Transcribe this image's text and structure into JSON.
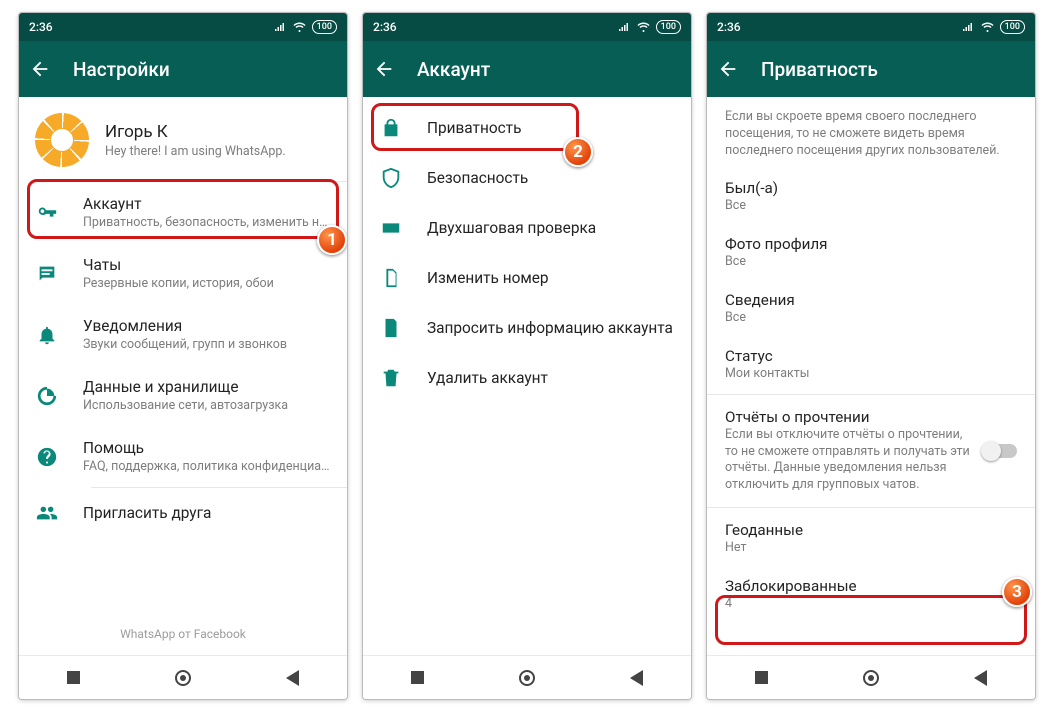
{
  "statusbar": {
    "time": "2:36",
    "battery": "100"
  },
  "screen1": {
    "title": "Настройки",
    "profile": {
      "name": "Игорь К",
      "status": "Hey there! I am using WhatsApp."
    },
    "items": [
      {
        "title": "Аккаунт",
        "sub": "Приватность, безопасность, изменить номер"
      },
      {
        "title": "Чаты",
        "sub": "Резервные копии, история, обои"
      },
      {
        "title": "Уведомления",
        "sub": "Звуки сообщений, групп и звонков"
      },
      {
        "title": "Данные и хранилище",
        "sub": "Использование сети, автозагрузка"
      },
      {
        "title": "Помощь",
        "sub": "FAQ, поддержка, политика конфиденциальн…"
      },
      {
        "title": "Пригласить друга",
        "sub": ""
      }
    ],
    "footer": "WhatsApp от Facebook",
    "badge": "1"
  },
  "screen2": {
    "title": "Аккаунт",
    "items": [
      {
        "title": "Приватность"
      },
      {
        "title": "Безопасность"
      },
      {
        "title": "Двухшаговая проверка"
      },
      {
        "title": "Изменить номер"
      },
      {
        "title": "Запросить информацию аккаунта"
      },
      {
        "title": "Удалить аккаунт"
      }
    ],
    "badge": "2"
  },
  "screen3": {
    "title": "Приватность",
    "hint": "Если вы скроете время своего последнего посещения, то не сможете видеть время последнего посещения других пользователей.",
    "items": [
      {
        "title": "Был(-а)",
        "sub": "Все"
      },
      {
        "title": "Фото профиля",
        "sub": "Все"
      },
      {
        "title": "Сведения",
        "sub": "Все"
      },
      {
        "title": "Статус",
        "sub": "Мои контакты"
      }
    ],
    "reports": {
      "title": "Отчёты о прочтении",
      "sub": "Если вы отключите отчёты о прочтении, то не сможете отправлять и получать эти отчёты. Данные уведомления нельзя отключить для групповых чатов."
    },
    "geo": {
      "title": "Геоданные",
      "sub": "Нет"
    },
    "blocked": {
      "title": "Заблокированные",
      "sub": "4"
    },
    "badge": "3"
  }
}
